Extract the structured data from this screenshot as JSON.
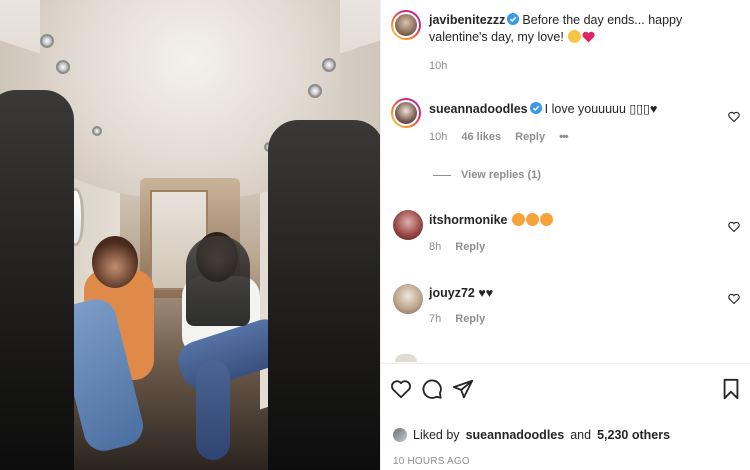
{
  "post": {
    "author": "javibenitezzz",
    "caption": "Before the day ends... happy valentine's day, my love!",
    "caption_emoji": [
      "smiling-face-emoji",
      "red-heart-emoji"
    ],
    "time": "10h"
  },
  "comments": [
    {
      "user": "sueannadoodles",
      "verified": true,
      "text": "I love youuuuu ▯▯▯♥",
      "time": "10h",
      "likes": "46 likes",
      "reply": "Reply",
      "more": "•••",
      "view_replies": "View replies (1)"
    },
    {
      "user": "itshormonike",
      "text": "",
      "emoji": [
        "star-struck-emoji",
        "star-struck-emoji",
        "star-struck-emoji"
      ],
      "time": "8h",
      "reply": "Reply"
    },
    {
      "user": "jouyz72",
      "text": "♥♥",
      "time": "7h",
      "reply": "Reply"
    }
  ],
  "likes_line": {
    "prefix": "Liked by",
    "user": "sueannadoodles",
    "and": "and",
    "others": "5,230 others"
  },
  "time_ago": "10 HOURS AGO",
  "colors": {
    "verified": "#3897f0",
    "heart": "#ed4956",
    "muted": "#8e8e8e",
    "text": "#262626"
  }
}
